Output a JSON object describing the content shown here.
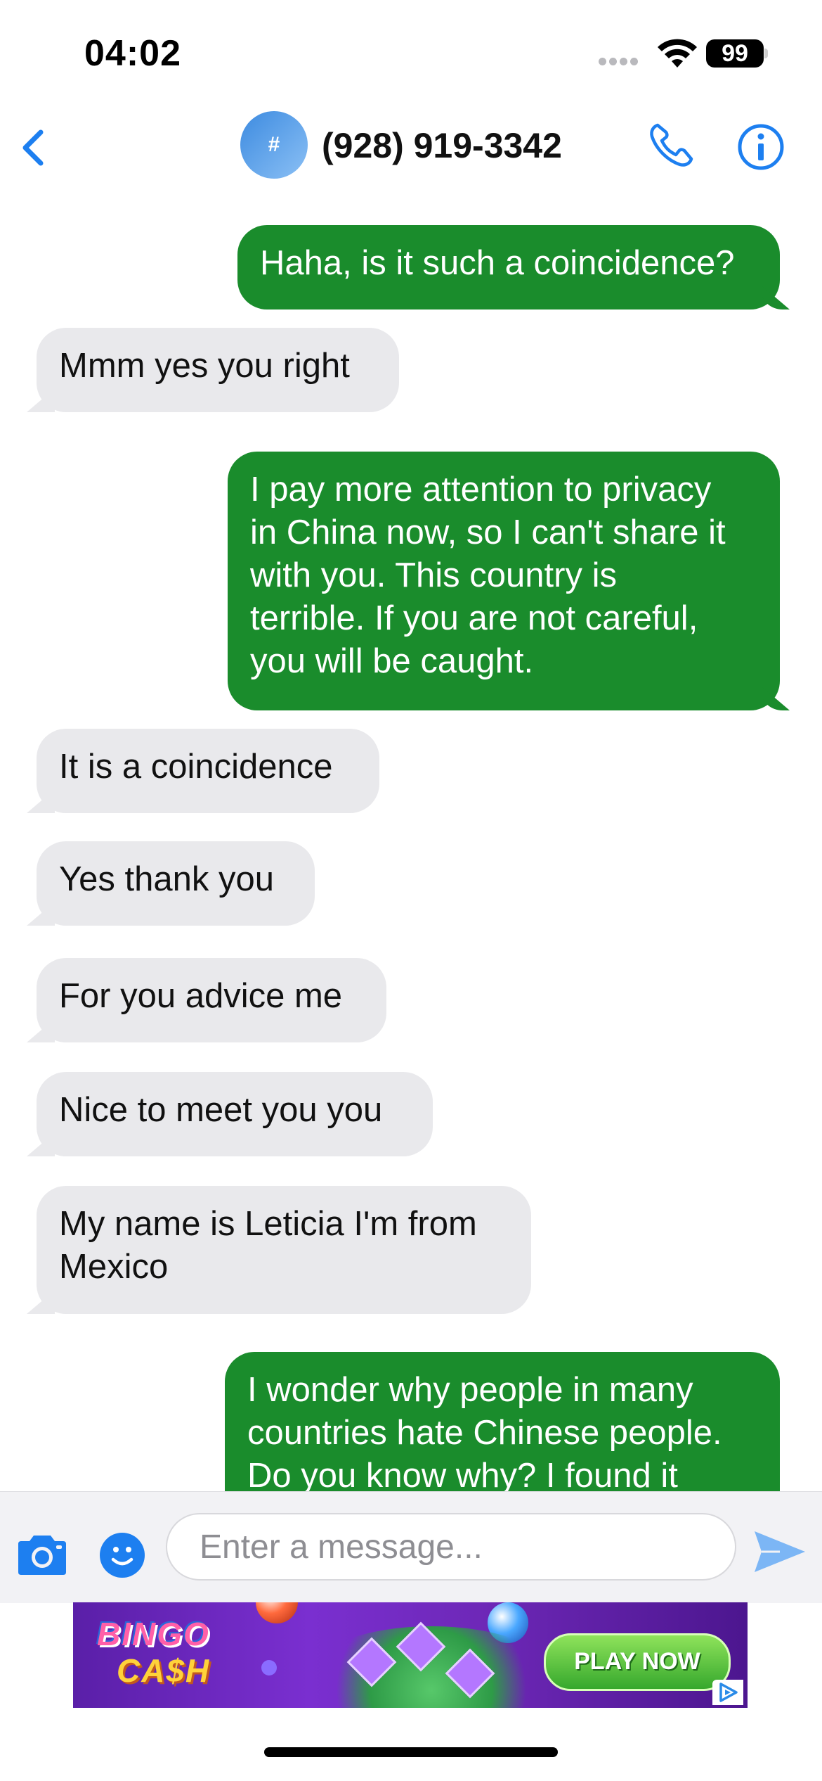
{
  "status_bar": {
    "time": "04:02",
    "battery": "99"
  },
  "nav": {
    "avatar_symbol": "#",
    "contact_number": "(928) 919-3342"
  },
  "messages": [
    {
      "direction": "outgoing",
      "text": "Haha, is it such a coincidence?"
    },
    {
      "direction": "incoming",
      "text": "Mmm yes you right"
    },
    {
      "direction": "outgoing",
      "text": "I pay more attention to privacy\nin China now, so I can't share it\nwith you. This country is\nterrible. If you are not careful,\nyou will be caught."
    },
    {
      "direction": "incoming",
      "text": "It is a coincidence"
    },
    {
      "direction": "incoming",
      "text": "Yes thank you"
    },
    {
      "direction": "incoming",
      "text": "For you advice me"
    },
    {
      "direction": "incoming",
      "text": "Nice to meet you you"
    },
    {
      "direction": "incoming",
      "text": "My name is Leticia I'm from\nMexico"
    },
    {
      "direction": "outgoing",
      "text": "I wonder why people in many\ncountries hate Chinese people.\nDo you know why? I found it"
    }
  ],
  "input": {
    "placeholder": "Enter a message..."
  },
  "ad": {
    "logo_line1": "BINGO",
    "logo_line2": "CA$H",
    "cta": "PLAY NOW"
  },
  "colors": {
    "accent": "#1d7ff0",
    "outgoing_bubble": "#1a8c2c",
    "incoming_bubble": "#e9e9ec"
  },
  "icons": [
    "back-chevron-icon",
    "phone-icon",
    "info-icon",
    "camera-icon",
    "emoji-icon",
    "send-icon",
    "wifi-icon",
    "ad-choices-icon"
  ]
}
